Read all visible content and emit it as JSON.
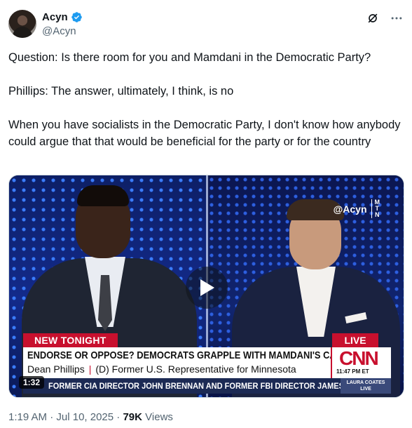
{
  "author": {
    "name": "Acyn",
    "handle": "@Acyn",
    "verified": true
  },
  "icons": {
    "grok": "grok-icon",
    "more": "more-icon",
    "verified": "verified-badge-icon",
    "play": "play-icon"
  },
  "tweet": {
    "paragraphs": [
      "Question: Is there room for you and Mamdani in the Democratic Party?",
      "Phillips: The answer, ultimately, I think, is no",
      "When you have socialists in the Democratic Party, I don't know how anybody could argue that that would be beneficial for the party or for the country"
    ]
  },
  "video": {
    "duration": "1:32",
    "watermark": "@Acyn",
    "watermark_brand": [
      "M",
      "T",
      "N"
    ],
    "chyron": {
      "tag": "NEW TONIGHT",
      "live": "LIVE",
      "headline": "ENDORSE OR OPPOSE? DEMOCRATS GRAPPLE WITH MAMDANI'S CANDIDACY",
      "name": "Dean Phillips",
      "separator": "|",
      "title": "(D) Former U.S. Representative for Minnesota",
      "network": "CNN",
      "time": "11:47 PM ET",
      "ticker": "FORMER CIA DIRECTOR JOHN BRENNAN AND FORMER FBI DIRECTOR JAMES CO",
      "show_line1": "LAURA COATES",
      "show_line2": "LIVE"
    }
  },
  "meta": {
    "time": "1:19 AM",
    "dot": " · ",
    "date": "Jul 10, 2025",
    "views_count": "79K",
    "views_label": " Views"
  },
  "colors": {
    "verified": "#1d9bf0",
    "cnn_red": "#c8102e",
    "secondary_text": "#536471"
  }
}
